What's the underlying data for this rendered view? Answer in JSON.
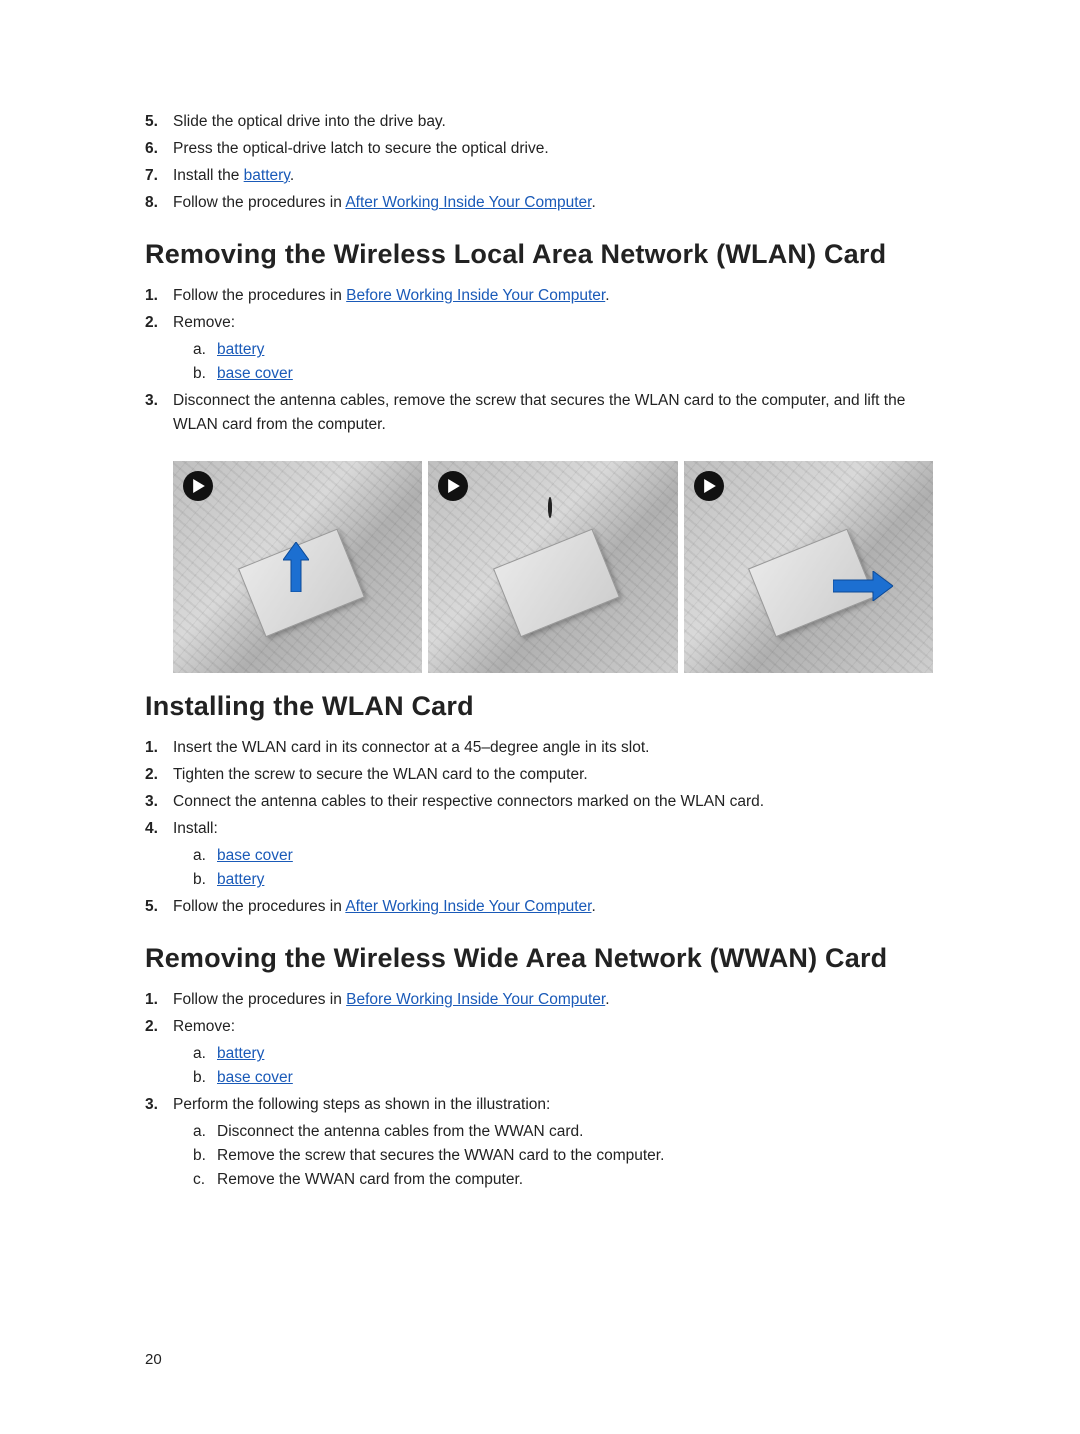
{
  "topList": {
    "start": 5,
    "items": [
      {
        "n": "5.",
        "text": "Slide the optical drive into the drive bay."
      },
      {
        "n": "6.",
        "text": "Press the optical-drive latch to secure the optical drive."
      },
      {
        "n": "7.",
        "parts": [
          {
            "text": "Install the "
          },
          {
            "link": "battery",
            "target": "battery"
          },
          {
            "text": "."
          }
        ]
      },
      {
        "n": "8.",
        "parts": [
          {
            "text": "Follow the procedures in "
          },
          {
            "link": "After Working Inside Your Computer",
            "target": "after-working"
          },
          {
            "text": "."
          }
        ]
      }
    ]
  },
  "section1": {
    "heading": "Removing the Wireless Local Area Network (WLAN) Card",
    "items": [
      {
        "n": "1.",
        "parts": [
          {
            "text": "Follow the procedures in "
          },
          {
            "link": "Before Working Inside Your Computer",
            "target": "before-working"
          },
          {
            "text": "."
          }
        ]
      },
      {
        "n": "2.",
        "text": "Remove:",
        "sub": [
          {
            "l": "a.",
            "link": "battery",
            "target": "battery"
          },
          {
            "l": "b.",
            "link": "base cover",
            "target": "base-cover"
          }
        ]
      },
      {
        "n": "3.",
        "text": "Disconnect the antenna cables, remove the screw that secures the WLAN card to the computer, and lift the WLAN card from the computer."
      }
    ]
  },
  "figure": {
    "panels": 3,
    "icon": "play-icon"
  },
  "section2": {
    "heading": "Installing the WLAN Card",
    "items": [
      {
        "n": "1.",
        "text": "Insert the WLAN card in its connector at a 45–degree angle in its slot."
      },
      {
        "n": "2.",
        "text": "Tighten the screw to secure the WLAN card to the computer."
      },
      {
        "n": "3.",
        "text": "Connect the antenna cables to their respective connectors marked on the WLAN card."
      },
      {
        "n": "4.",
        "text": "Install:",
        "sub": [
          {
            "l": "a.",
            "link": "base cover",
            "target": "base-cover"
          },
          {
            "l": "b.",
            "link": "battery",
            "target": "battery"
          }
        ]
      },
      {
        "n": "5.",
        "parts": [
          {
            "text": "Follow the procedures in "
          },
          {
            "link": "After Working Inside Your Computer",
            "target": "after-working"
          },
          {
            "text": "."
          }
        ]
      }
    ]
  },
  "section3": {
    "heading": "Removing the Wireless Wide Area Network (WWAN) Card",
    "items": [
      {
        "n": "1.",
        "parts": [
          {
            "text": "Follow the procedures in "
          },
          {
            "link": "Before Working Inside Your Computer",
            "target": "before-working"
          },
          {
            "text": "."
          }
        ]
      },
      {
        "n": "2.",
        "text": "Remove:",
        "sub": [
          {
            "l": "a.",
            "link": "battery",
            "target": "battery"
          },
          {
            "l": "b.",
            "link": "base cover",
            "target": "base-cover"
          }
        ]
      },
      {
        "n": "3.",
        "text": "Perform the following steps as shown in the illustration:",
        "sub": [
          {
            "l": "a.",
            "text": "Disconnect the antenna cables from the WWAN card."
          },
          {
            "l": "b.",
            "text": "Remove the screw that secures the WWAN card to the computer."
          },
          {
            "l": "c.",
            "text": "Remove the WWAN card from the computer."
          }
        ]
      }
    ]
  },
  "pageNumber": "20"
}
